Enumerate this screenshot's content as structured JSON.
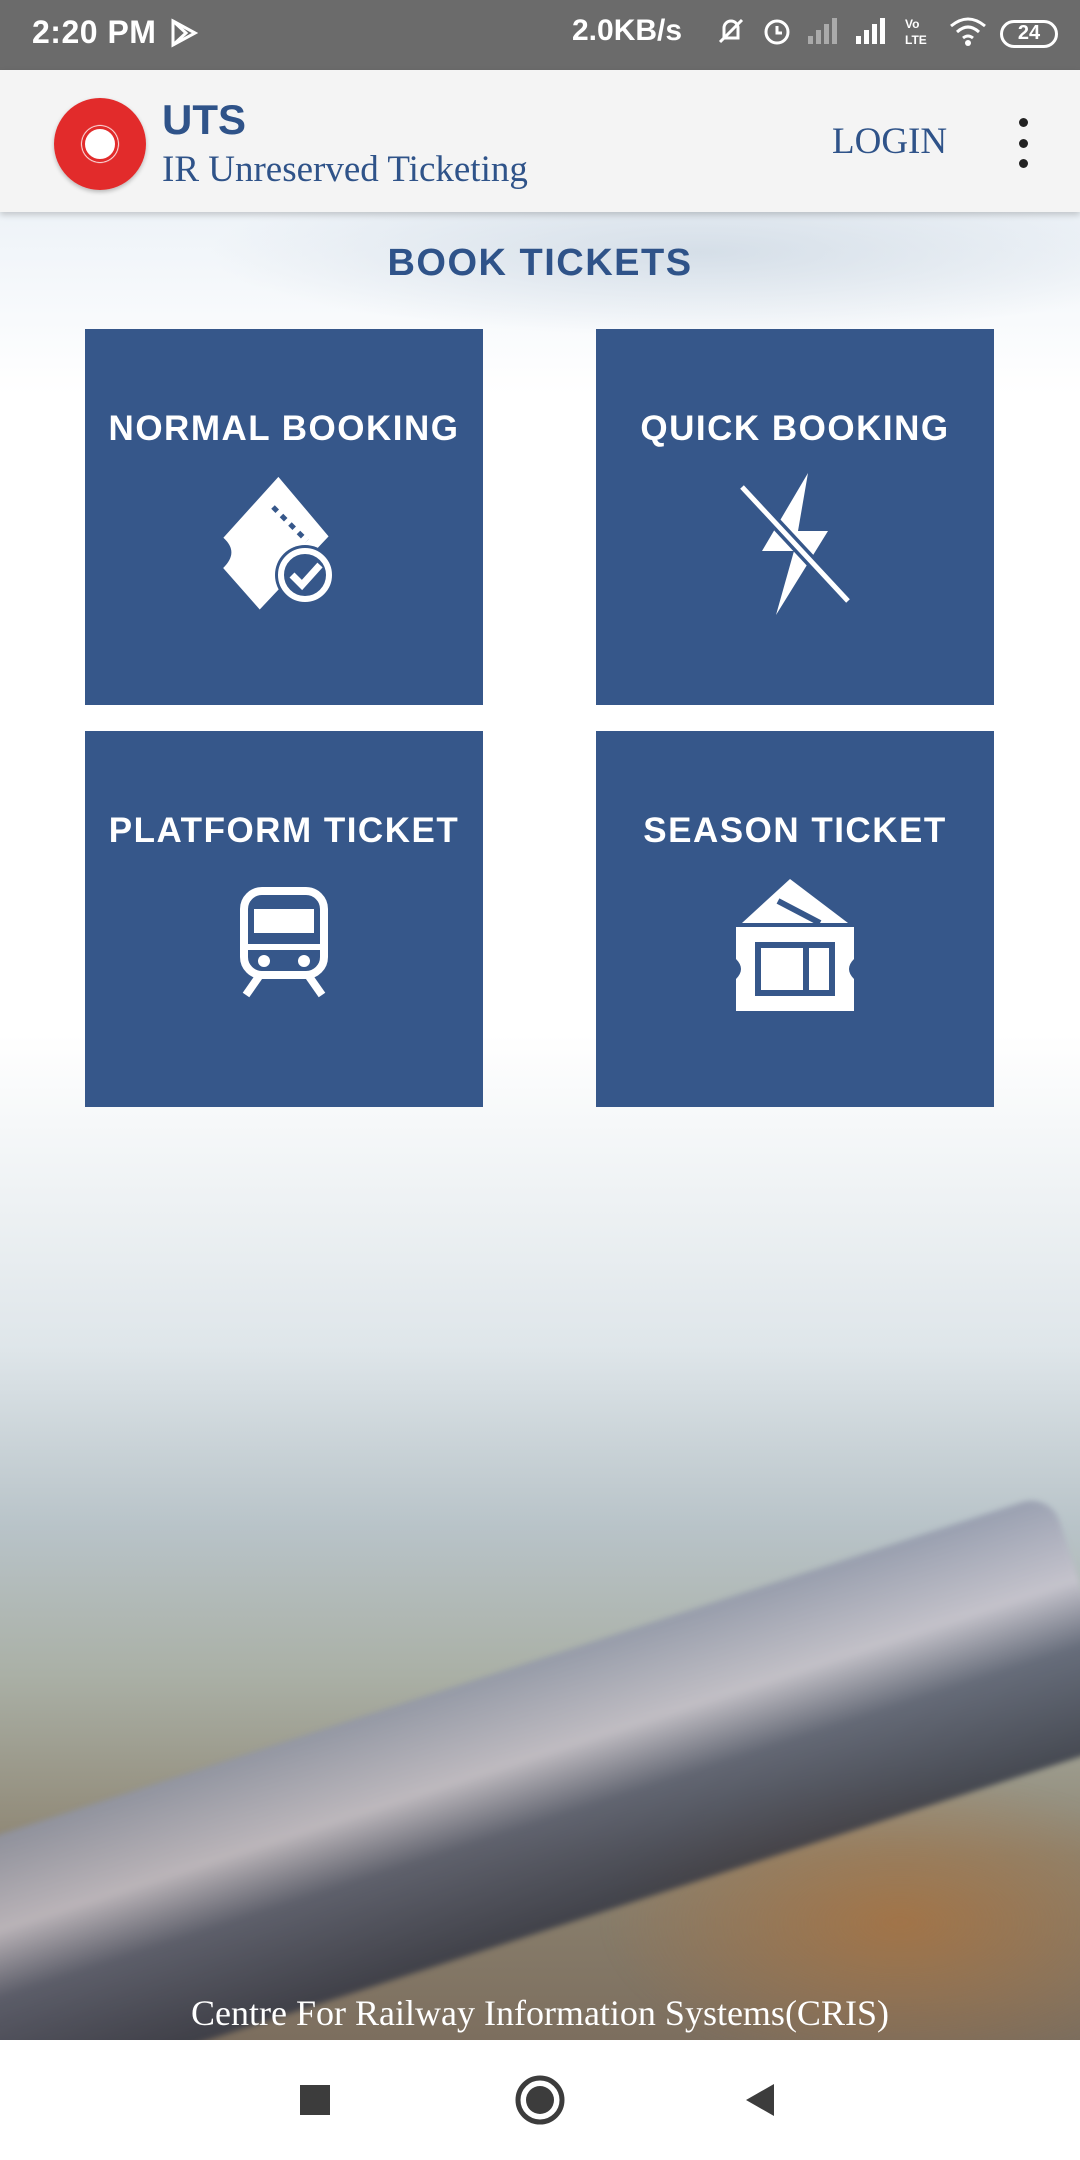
{
  "status_bar": {
    "time": "2:20 PM",
    "speed": "2.0KB/s",
    "battery": "24",
    "icons": [
      "play-store-icon",
      "mute-icon",
      "alarm-icon",
      "signal-icon",
      "volte-icon",
      "wifi-icon",
      "battery-icon"
    ]
  },
  "appbar": {
    "title": "UTS",
    "subtitle": "IR Unreserved Ticketing",
    "login_label": "LOGIN",
    "menu_icon": "more-vert-icon"
  },
  "main": {
    "section_title": "BOOK TICKETS",
    "tiles": [
      {
        "label": "NORMAL BOOKING",
        "icon": "ticket-check-icon"
      },
      {
        "label": "QUICK BOOKING",
        "icon": "lightning-off-icon"
      },
      {
        "label": "PLATFORM TICKET",
        "icon": "train-icon"
      },
      {
        "label": "SEASON TICKET",
        "icon": "season-ticket-icon"
      }
    ],
    "tile_color": "#36578a"
  },
  "footer": {
    "credit": "Centre For Railway Information Systems(CRIS)"
  },
  "nav": {
    "buttons": [
      "recents-button",
      "home-button",
      "back-button"
    ]
  }
}
